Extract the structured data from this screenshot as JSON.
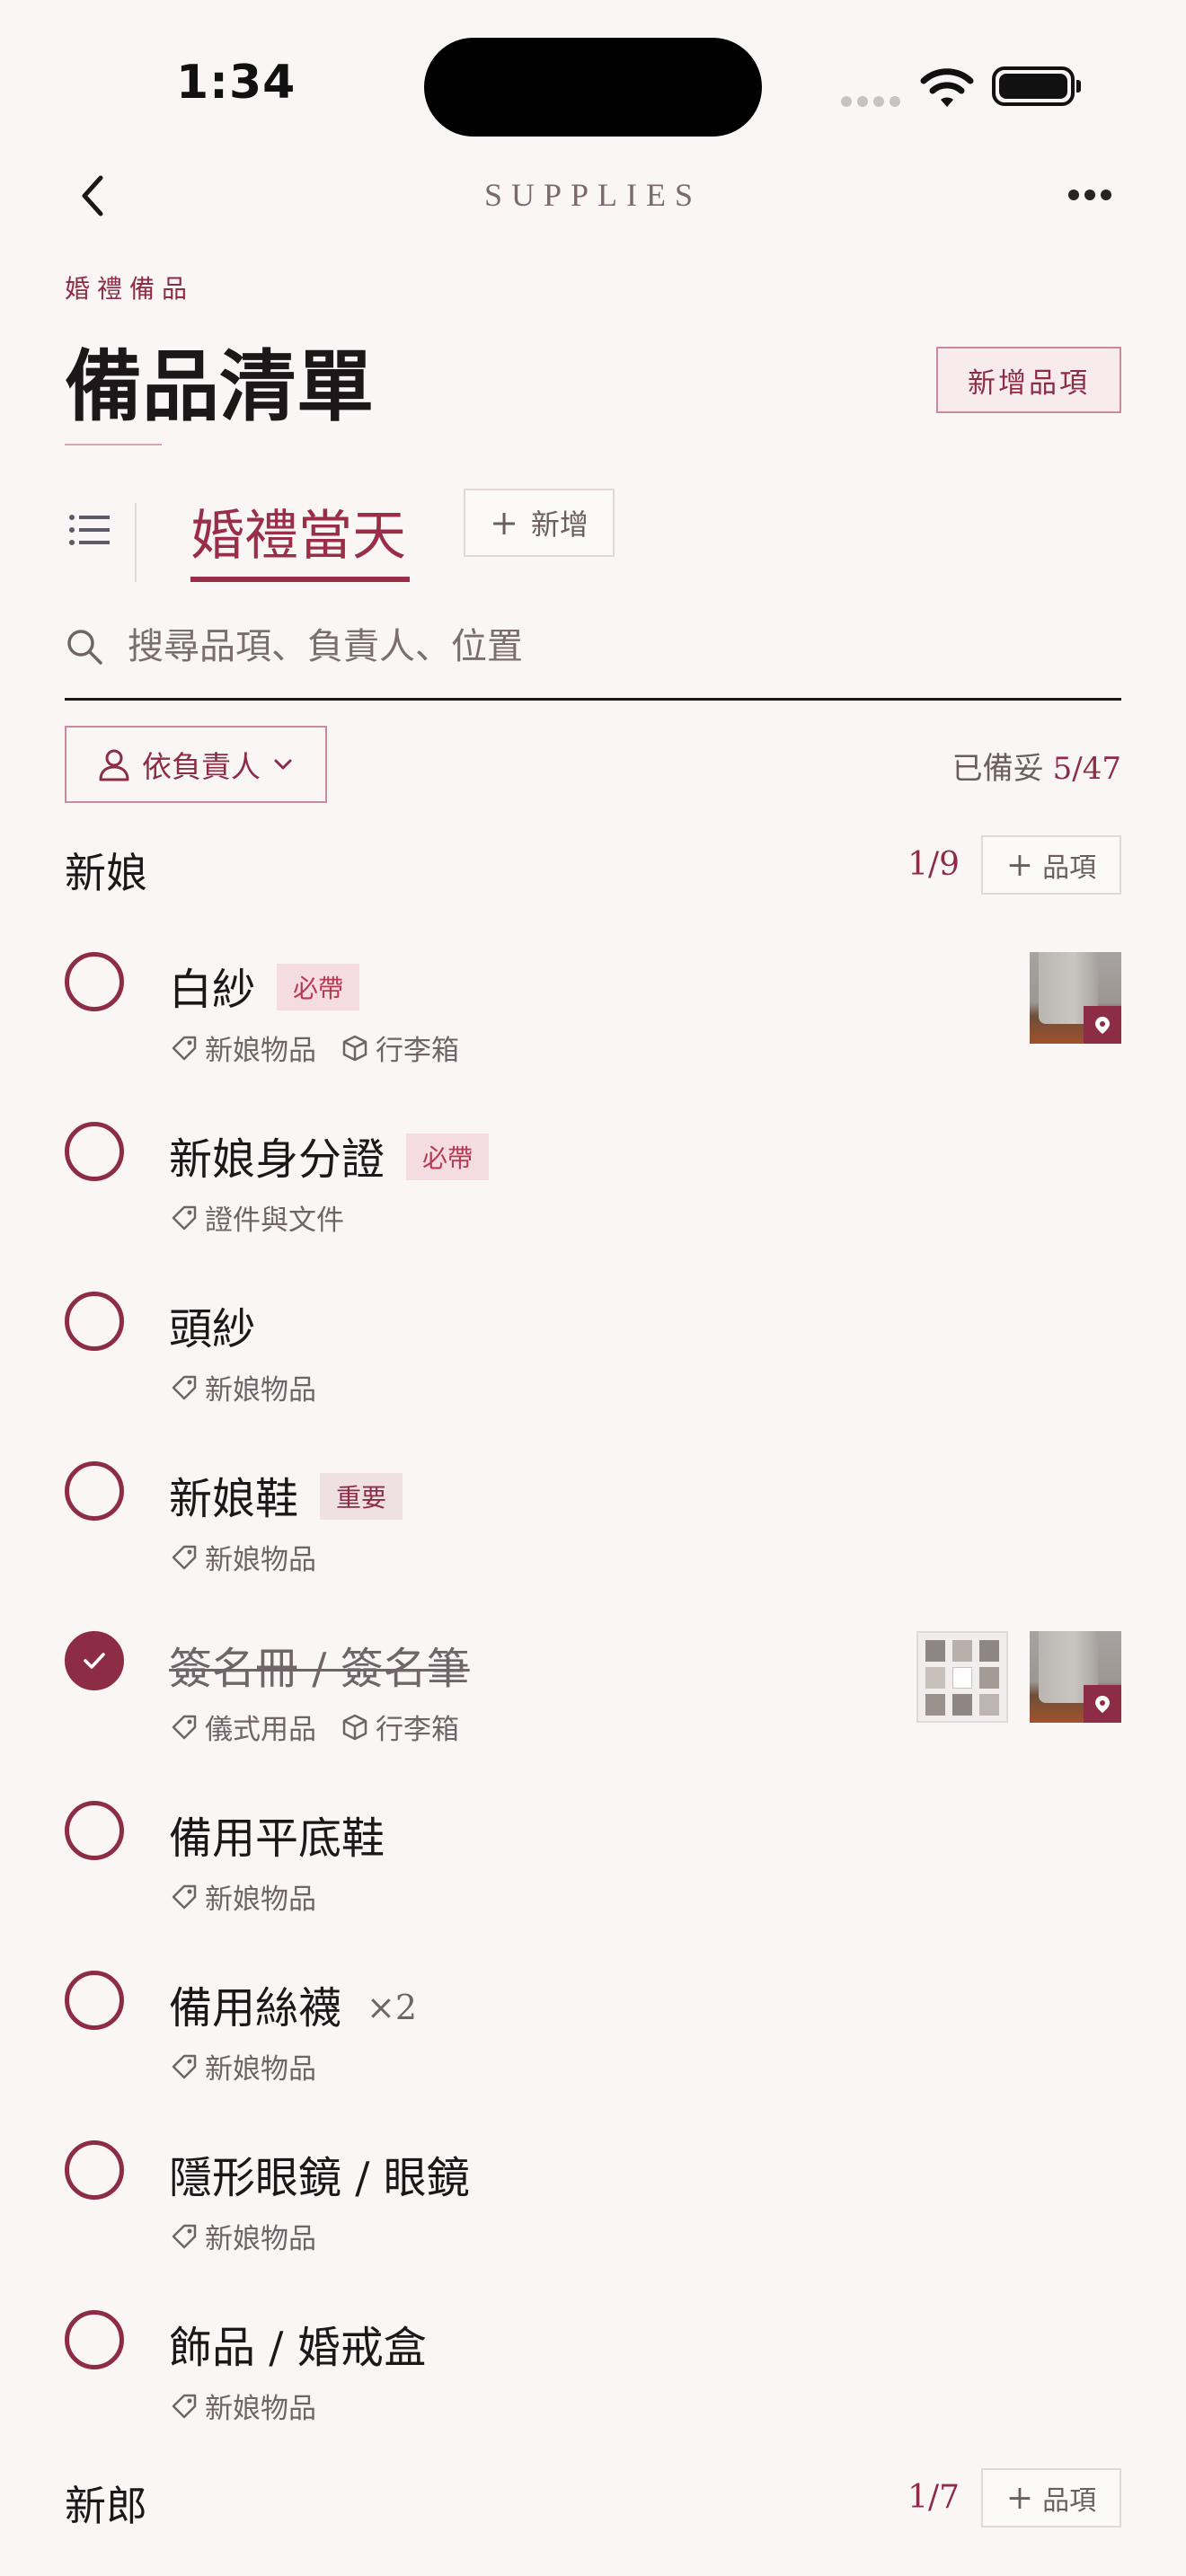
{
  "status_bar": {
    "time": "1:34"
  },
  "nav": {
    "title": "SUPPLIES",
    "back_icon": "chevron-left-icon",
    "more_icon": "ellipsis-icon"
  },
  "header": {
    "eyebrow": "婚禮備品",
    "title": "備品清單",
    "add_button": "新增品項"
  },
  "tabs": {
    "active": "婚禮當天",
    "add_label": "新增"
  },
  "search": {
    "placeholder": "搜尋品項、負責人、位置",
    "value": ""
  },
  "filter": {
    "label": "依負責人",
    "icon": "person-icon"
  },
  "progress": {
    "label": "已備妥",
    "value": "5/47"
  },
  "colors": {
    "accent": "#8C2D45",
    "background": "#FAF6F6",
    "badge_required_bg": "#F4DCE0",
    "badge_required_text": "#B73A52"
  },
  "sections": [
    {
      "name": "新娘",
      "count": "1/9",
      "add_label": "品項",
      "items": [
        {
          "name": "白紗",
          "badge": "必帶",
          "category": "新娘物品",
          "location": "行李箱",
          "done": false,
          "thumbs": [
            "luggage"
          ]
        },
        {
          "name": "新娘身分證",
          "badge": "必帶",
          "category": "證件與文件",
          "done": false
        },
        {
          "name": "頭紗",
          "category": "新娘物品",
          "done": false
        },
        {
          "name": "新娘鞋",
          "badge": "重要",
          "category": "新娘物品",
          "done": false
        },
        {
          "name": "簽名冊 / 簽名筆",
          "category": "儀式用品",
          "location": "行李箱",
          "done": true,
          "thumbs": [
            "photos",
            "luggage"
          ]
        },
        {
          "name": "備用平底鞋",
          "category": "新娘物品",
          "done": false
        },
        {
          "name": "備用絲襪",
          "quantity": "×2",
          "category": "新娘物品",
          "done": false
        },
        {
          "name": "隱形眼鏡 / 眼鏡",
          "category": "新娘物品",
          "done": false
        },
        {
          "name": "飾品 / 婚戒盒",
          "category": "新娘物品",
          "done": false
        }
      ]
    },
    {
      "name": "新郎",
      "count": "1/7",
      "add_label": "品項"
    }
  ]
}
